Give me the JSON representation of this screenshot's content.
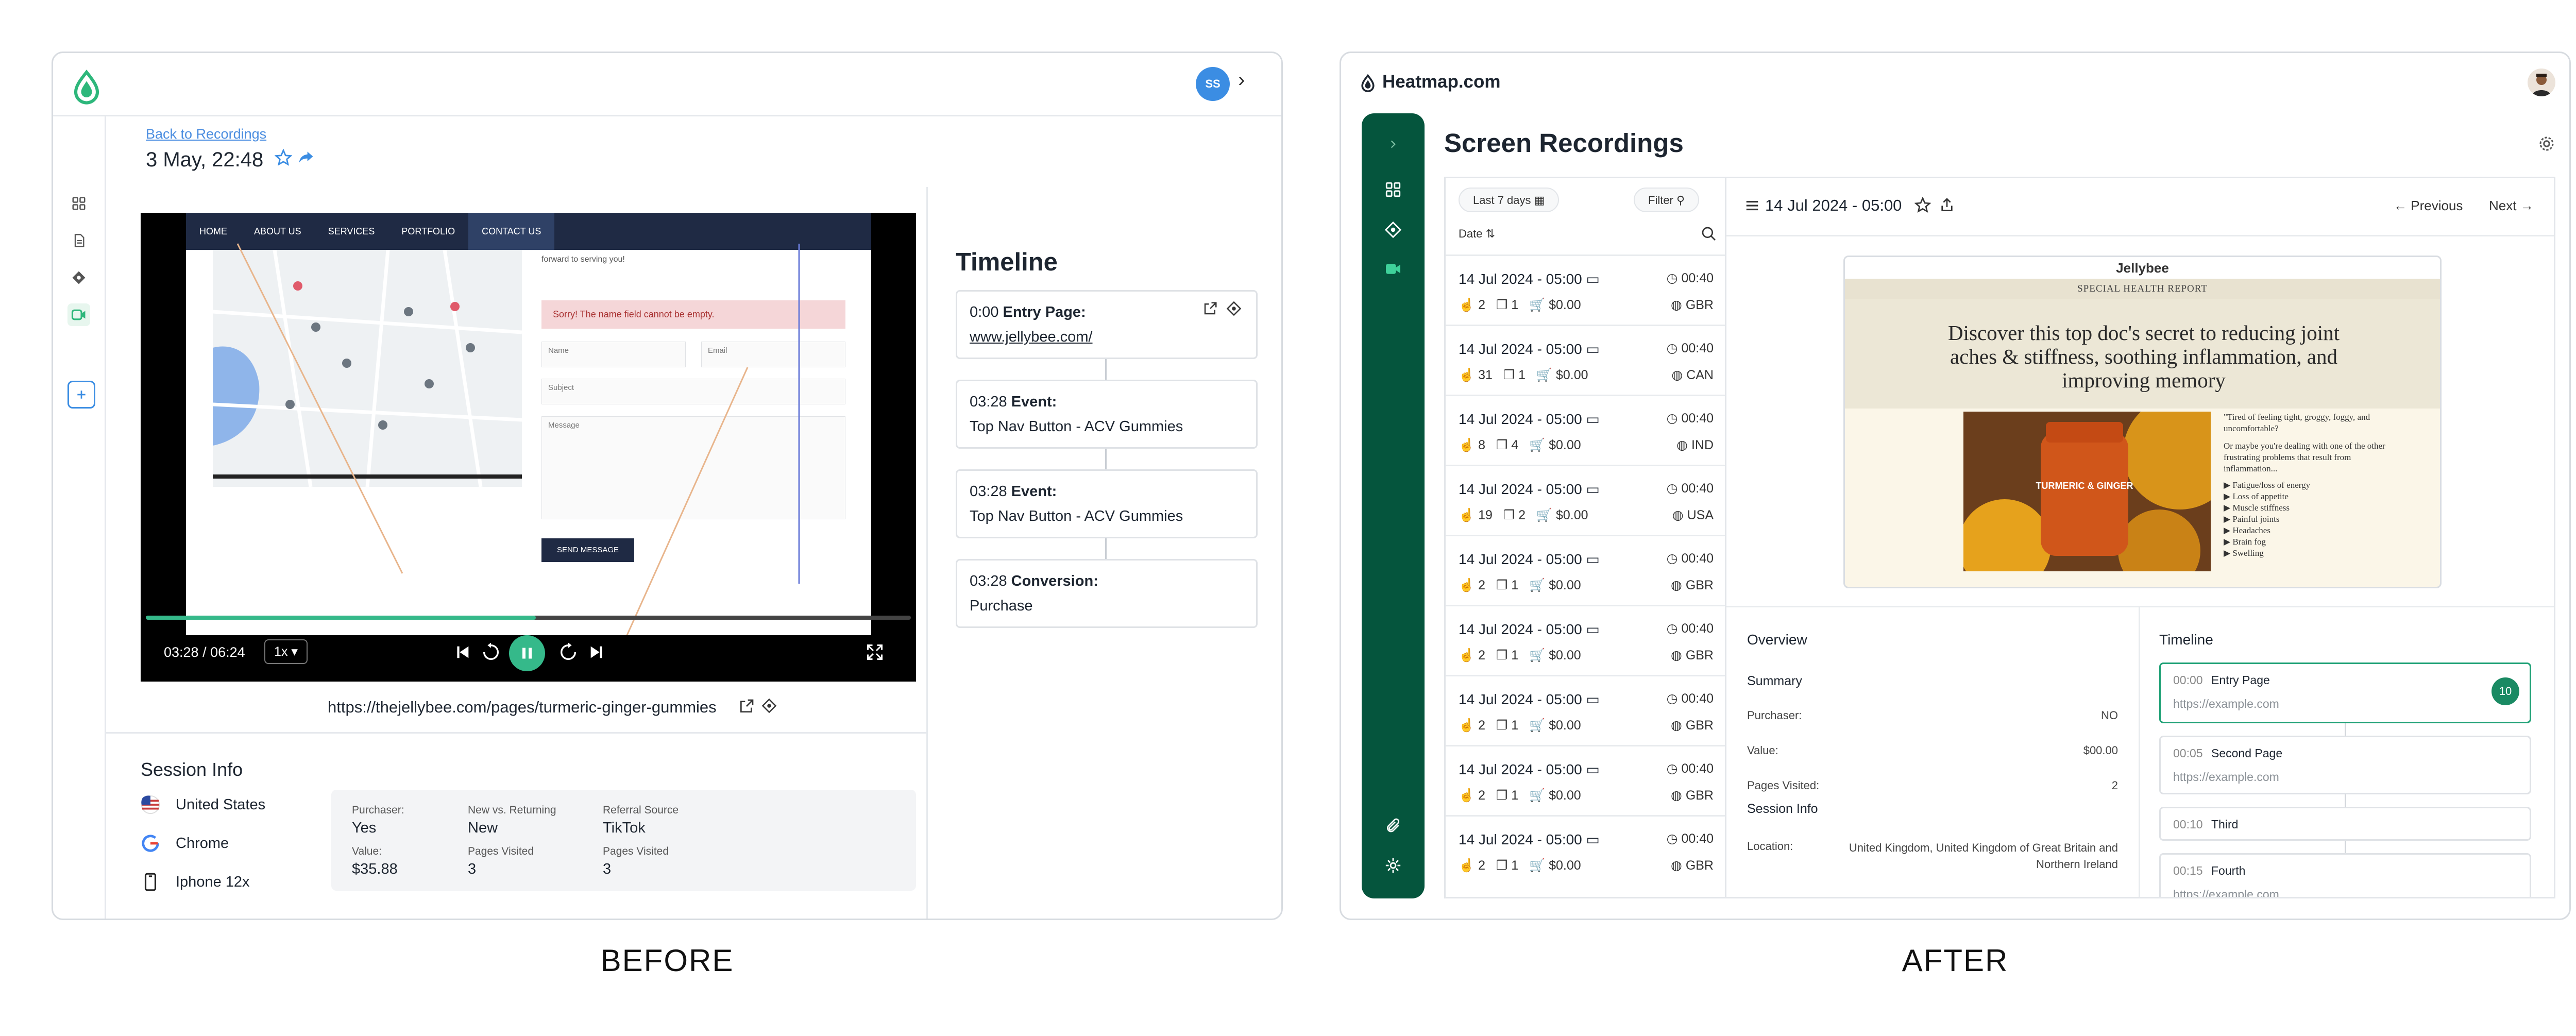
{
  "captions": {
    "before": "BEFORE",
    "after": "AFTER"
  },
  "before": {
    "avatar_initials": "SS",
    "back_link": "Back to Recordings",
    "recording_date": "3 May, 22:48",
    "site_nav": [
      "HOME",
      "ABOUT US",
      "SERVICES",
      "PORTFOLIO",
      "CONTACT US"
    ],
    "site_form": {
      "intro": "forward to serving you!",
      "error": "Sorry! The name field cannot be empty.",
      "name_placeholder": "Name",
      "email_placeholder": "Email",
      "subject_placeholder": "Subject",
      "message_placeholder": "Message",
      "send_label": "SEND MESSAGE"
    },
    "player": {
      "time": "03:28 / 06:24",
      "speed": "1x",
      "progress": 0.51
    },
    "page_url": "https://thejellybee.com/pages/turmeric-ginger-gummies",
    "session_info": {
      "title": "Session Info",
      "country": "United States",
      "browser": "Chrome",
      "device": "Iphone 12x",
      "fields": [
        {
          "label": "Purchaser:",
          "value": "Yes"
        },
        {
          "label": "New vs. Returning",
          "value": "New"
        },
        {
          "label": "Referral Source",
          "value": "TikTok"
        },
        {
          "label": "Value:",
          "value": "$35.88"
        },
        {
          "label": "Pages Visited",
          "value": "3"
        },
        {
          "label": "Pages Visited",
          "value": "3"
        }
      ]
    },
    "timeline": {
      "title": "Timeline",
      "events": [
        {
          "time": "0:00",
          "type": "Entry Page:",
          "detail": "www.jellybee.com/"
        },
        {
          "time": "03:28",
          "type": "Event:",
          "detail": "Top Nav Button - ACV Gummies"
        },
        {
          "time": "03:28",
          "type": "Event:",
          "detail": "Top Nav Button - ACV Gummies"
        },
        {
          "time": "03:28",
          "type": "Conversion:",
          "detail": "Purchase"
        }
      ]
    }
  },
  "after": {
    "brand": "Heatmap.com",
    "page_title": "Screen Recordings",
    "filters": {
      "range": "Last 7 days",
      "filter": "Filter",
      "sort": "Date"
    },
    "recordings": [
      {
        "date": "14 Jul 2024 - 05:00",
        "duration": "00:40",
        "clicks": "2",
        "pages": "1",
        "value": "$0.00",
        "country": "GBR"
      },
      {
        "date": "14 Jul 2024 - 05:00",
        "duration": "00:40",
        "clicks": "31",
        "pages": "1",
        "value": "$0.00",
        "country": "CAN"
      },
      {
        "date": "14 Jul 2024 - 05:00",
        "duration": "00:40",
        "clicks": "8",
        "pages": "4",
        "value": "$0.00",
        "country": "IND"
      },
      {
        "date": "14 Jul 2024 - 05:00",
        "duration": "00:40",
        "clicks": "19",
        "pages": "2",
        "value": "$0.00",
        "country": "USA"
      },
      {
        "date": "14 Jul 2024 - 05:00",
        "duration": "00:40",
        "clicks": "2",
        "pages": "1",
        "value": "$0.00",
        "country": "GBR"
      },
      {
        "date": "14 Jul 2024 - 05:00",
        "duration": "00:40",
        "clicks": "2",
        "pages": "1",
        "value": "$0.00",
        "country": "GBR"
      },
      {
        "date": "14 Jul 2024 - 05:00",
        "duration": "00:40",
        "clicks": "2",
        "pages": "1",
        "value": "$0.00",
        "country": "GBR"
      },
      {
        "date": "14 Jul 2024 - 05:00",
        "duration": "00:40",
        "clicks": "2",
        "pages": "1",
        "value": "$0.00",
        "country": "GBR"
      },
      {
        "date": "14 Jul 2024 - 05:00",
        "duration": "00:40",
        "clicks": "2",
        "pages": "1",
        "value": "$0.00",
        "country": "GBR"
      }
    ],
    "detail": {
      "date": "14 Jul 2024 - 05:00",
      "previous": "Previous",
      "next": "Next",
      "preview": {
        "brand": "Jellybee",
        "band": "SPECIAL HEALTH REPORT",
        "headline": "Discover this top doc's secret to reducing joint aches & stiffness, soothing inflammation, and improving memory",
        "jar_label": "TURMERIC & GINGER",
        "intro": "\"Tired of feeling tight, groggy, foggy, and uncomfortable?",
        "intro2": "Or maybe you're dealing with one of the other frustrating problems that result from inflammation...",
        "bullets": [
          "Fatigue/loss of energy",
          "Loss of appetite",
          "Muscle stiffness",
          "Painful joints",
          "Headaches",
          "Brain fog",
          "Swelling"
        ]
      },
      "overview_title": "Overview",
      "summary_title": "Summary",
      "summary": [
        {
          "label": "Purchaser:",
          "value": "NO"
        },
        {
          "label": "Value:",
          "value": "$00.00"
        },
        {
          "label": "Pages Visited:",
          "value": "2"
        }
      ],
      "session_info_title": "Session Info",
      "location_label": "Location:",
      "location_value": "United Kingdom, United Kingdom of Great Britain and Northern Ireland",
      "timeline_title": "Timeline",
      "timeline": [
        {
          "time": "00:00",
          "name": "Entry Page",
          "url": "https://example.com",
          "badge": "10",
          "active": true
        },
        {
          "time": "00:05",
          "name": "Second Page",
          "url": "https://example.com"
        },
        {
          "time": "00:10",
          "name": "Third"
        },
        {
          "time": "00:15",
          "name": "Fourth",
          "url": "https://example.com"
        }
      ]
    }
  }
}
